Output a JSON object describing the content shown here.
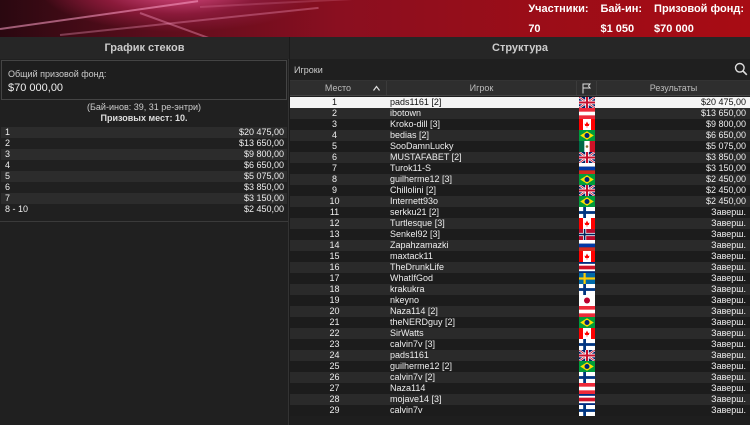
{
  "header": {
    "stats": [
      {
        "label": "Участники:",
        "value": "70"
      },
      {
        "label": "Бай-ин:",
        "value": "$1 050"
      },
      {
        "label": "Призовой фонд:",
        "value": "$70 000"
      }
    ]
  },
  "sections": {
    "left_title": "График стеков",
    "right_title": "Структура"
  },
  "left": {
    "prize_label": "Общий призовой фонд:",
    "prize_value": "$70 000,00",
    "buyins_info": "(Бай-инов: 39, 31 ре-энтри)",
    "paid_places": "Призовых мест: 10.",
    "payouts": [
      {
        "place": "1",
        "amount": "$20 475,00"
      },
      {
        "place": "2",
        "amount": "$13 650,00"
      },
      {
        "place": "3",
        "amount": "$9 800,00"
      },
      {
        "place": "4",
        "amount": "$6 650,00"
      },
      {
        "place": "5",
        "amount": "$5 075,00"
      },
      {
        "place": "6",
        "amount": "$3 850,00"
      },
      {
        "place": "7",
        "amount": "$3 150,00"
      },
      {
        "place": "8 - 10",
        "amount": "$2 450,00"
      }
    ]
  },
  "table": {
    "search_placeholder": "Игроки",
    "columns": {
      "place": "Место",
      "player": "Игрок",
      "results": "Результаты"
    },
    "flag_colors": {
      "gb": [
        "#012169",
        "#ffffff",
        "#c8102e"
      ],
      "at": [
        "#ed2939",
        "#ffffff"
      ],
      "ca": [
        "#ff0000",
        "#ffffff"
      ],
      "br": [
        "#009c3b",
        "#ffdf00",
        "#002776"
      ],
      "mx": [
        "#006847",
        "#ffffff",
        "#ce1126"
      ],
      "ru": [
        "#ffffff",
        "#0039a6",
        "#d52b1e"
      ],
      "no": [
        "#ba0c2f",
        "#ffffff",
        "#00205b"
      ],
      "fi": [
        "#ffffff",
        "#003580"
      ],
      "cr": [
        "#002b7f",
        "#ffffff",
        "#ce1126"
      ],
      "se": [
        "#006aa7",
        "#fecc00"
      ],
      "jp": [
        "#ffffff",
        "#bc002d"
      ]
    },
    "rows": [
      {
        "place": "1",
        "player": "pads1161 [2]",
        "flag": "gb",
        "result": "$20 475,00"
      },
      {
        "place": "2",
        "player": "ibotown",
        "flag": "at",
        "result": "$13 650,00"
      },
      {
        "place": "3",
        "player": "Kroko-dill [3]",
        "flag": "ca",
        "result": "$9 800,00"
      },
      {
        "place": "4",
        "player": "bedias [2]",
        "flag": "br",
        "result": "$6 650,00"
      },
      {
        "place": "5",
        "player": "SooDamnLucky",
        "flag": "mx",
        "result": "$5 075,00"
      },
      {
        "place": "6",
        "player": "MUSTAFABET [2]",
        "flag": "gb",
        "result": "$3 850,00"
      },
      {
        "place": "7",
        "player": "Turok11-S",
        "flag": "ru",
        "result": "$3 150,00"
      },
      {
        "place": "8",
        "player": "guilherme12 [3]",
        "flag": "br",
        "result": "$2 450,00"
      },
      {
        "place": "9",
        "player": "Chillolini [2]",
        "flag": "gb",
        "result": "$2 450,00"
      },
      {
        "place": "10",
        "player": "Internett93o",
        "flag": "br",
        "result": "$2 450,00"
      },
      {
        "place": "11",
        "player": "serkku21 [2]",
        "flag": "fi",
        "result": "Заверш."
      },
      {
        "place": "12",
        "player": "Turtlesque [3]",
        "flag": "ca",
        "result": "Заверш."
      },
      {
        "place": "13",
        "player": "Senkel92 [3]",
        "flag": "no",
        "result": "Заверш."
      },
      {
        "place": "14",
        "player": "Zapahzamazki",
        "flag": "ru",
        "result": "Заверш."
      },
      {
        "place": "15",
        "player": "maxtack11",
        "flag": "ca",
        "result": "Заверш."
      },
      {
        "place": "16",
        "player": "TheDrunkLife",
        "flag": "cr",
        "result": "Заверш."
      },
      {
        "place": "17",
        "player": "WhatIfGod",
        "flag": "se",
        "result": "Заверш."
      },
      {
        "place": "18",
        "player": "krakukra",
        "flag": "fi",
        "result": "Заверш."
      },
      {
        "place": "19",
        "player": "nkeyno",
        "flag": "jp",
        "result": "Заверш."
      },
      {
        "place": "20",
        "player": "Naza114 [2]",
        "flag": "at",
        "result": "Заверш."
      },
      {
        "place": "21",
        "player": "theNERDguy [2]",
        "flag": "br",
        "result": "Заверш."
      },
      {
        "place": "22",
        "player": "SirWatts",
        "flag": "ca",
        "result": "Заверш."
      },
      {
        "place": "23",
        "player": "calvin7v [3]",
        "flag": "fi",
        "result": "Заверш."
      },
      {
        "place": "24",
        "player": "pads1161",
        "flag": "gb",
        "result": "Заверш."
      },
      {
        "place": "25",
        "player": "guilherme12 [2]",
        "flag": "br",
        "result": "Заверш."
      },
      {
        "place": "26",
        "player": "calvin7v [2]",
        "flag": "fi",
        "result": "Заверш."
      },
      {
        "place": "27",
        "player": "Naza114",
        "flag": "at",
        "result": "Заверш."
      },
      {
        "place": "28",
        "player": "mojave14 [3]",
        "flag": "cr",
        "result": "Заверш."
      },
      {
        "place": "29",
        "player": "calvin7v",
        "flag": "fi",
        "result": "Заверш."
      }
    ]
  }
}
